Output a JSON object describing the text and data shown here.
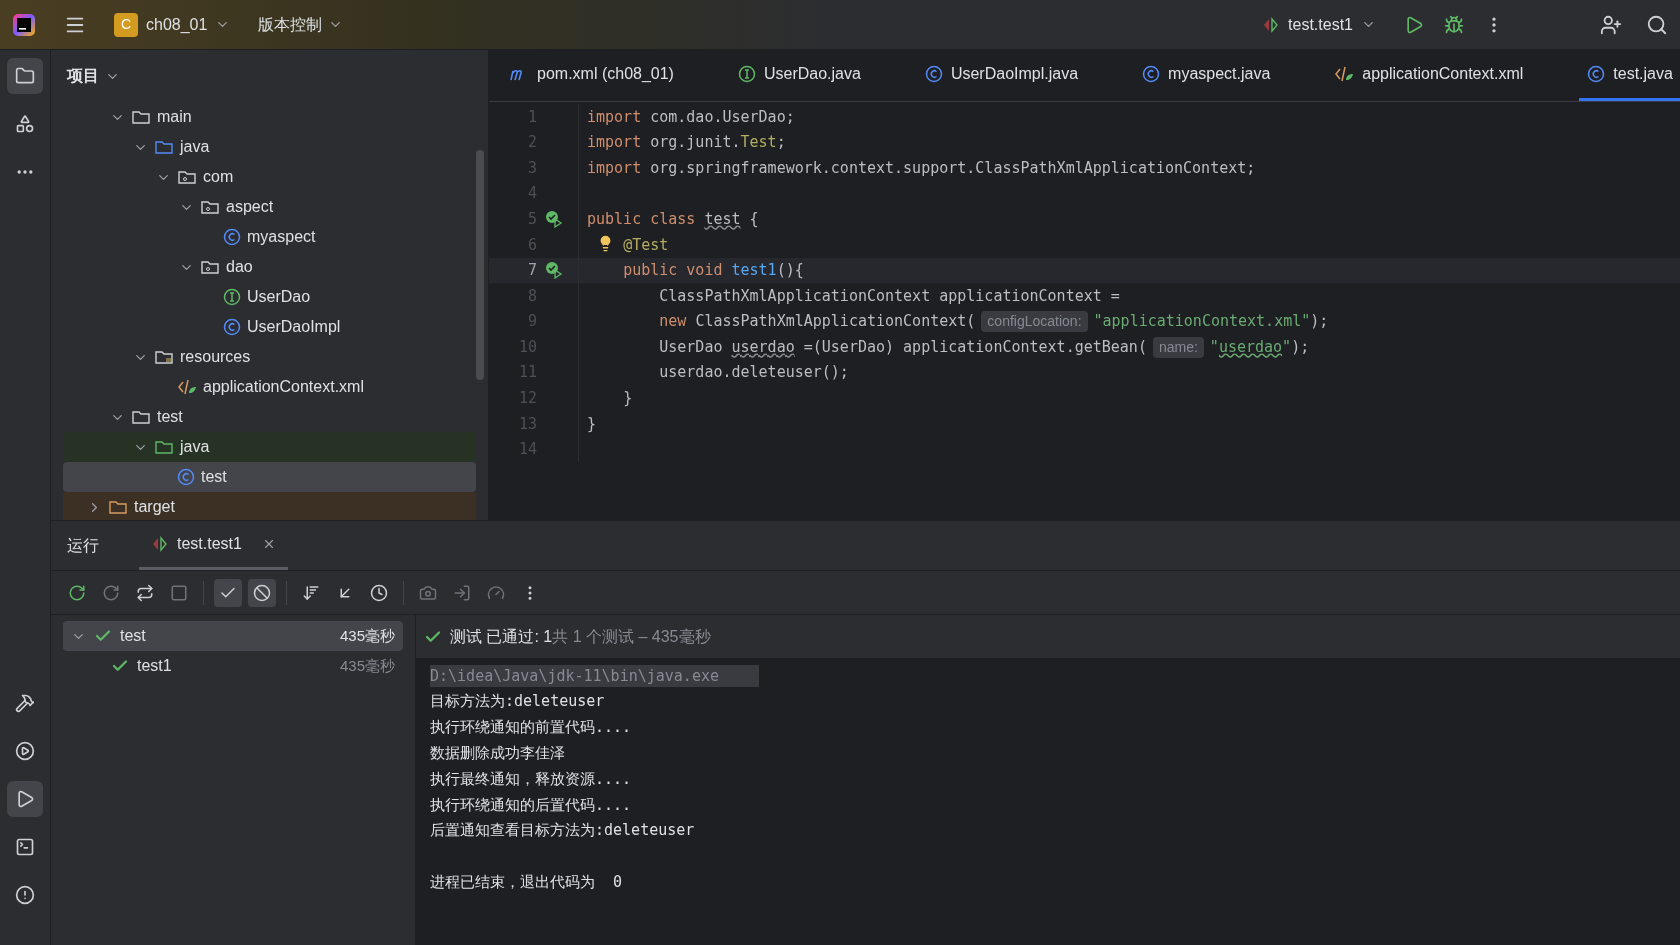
{
  "toolbar": {
    "project_badge": "C",
    "project": "ch08_01",
    "vcs": "版本控制",
    "run_config": "test.test1"
  },
  "left_strip": {
    "top": [
      {
        "kind": "folder",
        "selected": true
      },
      {
        "kind": "structure",
        "selected": false
      },
      {
        "kind": "more",
        "selected": false
      }
    ],
    "bottom": [
      {
        "kind": "build",
        "selected": false
      },
      {
        "kind": "services",
        "selected": false
      },
      {
        "kind": "run",
        "selected": true
      },
      {
        "kind": "terminal",
        "selected": false
      },
      {
        "kind": "problems",
        "selected": false
      }
    ]
  },
  "project_panel": {
    "title": "项目",
    "tree": [
      {
        "children": [
          {
            "label": "main",
            "kind": "folder",
            "expanded": true,
            "selected": false,
            "children": [
              {
                "label": "java",
                "kind": "source",
                "expanded": true,
                "selected": false,
                "children": [
                  {
                    "label": "com",
                    "kind": "package",
                    "expanded": true,
                    "selected": false,
                    "children": [
                      {
                        "label": "aspect",
                        "kind": "package",
                        "expanded": true,
                        "selected": false,
                        "children": [
                          {
                            "label": "myaspect",
                            "kind": "class",
                            "selected": false
                          }
                        ]
                      },
                      {
                        "label": "dao",
                        "kind": "package",
                        "expanded": true,
                        "selected": false,
                        "children": [
                          {
                            "label": "UserDao",
                            "kind": "interface",
                            "selected": false
                          },
                          {
                            "label": "UserDaoImpl",
                            "kind": "class",
                            "selected": false
                          }
                        ]
                      }
                    ]
                  }
                ]
              },
              {
                "label": "resources",
                "kind": "resources",
                "expanded": true,
                "selected": false,
                "children": [
                  {
                    "label": "applicationContext.xml",
                    "kind": "xml",
                    "selected": false
                  }
                ]
              }
            ]
          },
          {
            "label": "test",
            "kind": "folder",
            "expanded": true,
            "selected": false,
            "children": [
              {
                "label": "java",
                "kind": "test-source",
                "expanded": true,
                "selected": false,
                "children": [
                  {
                    "label": "test",
                    "kind": "class",
                    "selected": true
                  }
                ]
              }
            ]
          }
        ]
      },
      {
        "label": "target",
        "kind": "excluded",
        "expanded": false,
        "selected": false
      }
    ]
  },
  "editor_tabs": [
    {
      "label": "pom.xml (ch08_01)",
      "kind": "maven",
      "selected": false
    },
    {
      "label": "UserDao.java",
      "kind": "interface",
      "selected": false
    },
    {
      "label": "UserDaoImpl.java",
      "kind": "class",
      "selected": false
    },
    {
      "label": "myaspect.java",
      "kind": "class",
      "selected": false
    },
    {
      "label": "applicationContext.xml",
      "kind": "xml",
      "selected": false
    },
    {
      "label": "test.java",
      "kind": "class",
      "selected": true
    }
  ],
  "code": [
    {
      "number": "1",
      "tokens": [
        {
          "text": "import ",
          "kind": "keyword"
        },
        {
          "text": "com.dao.UserDao;",
          "kind": "plain"
        }
      ]
    },
    {
      "number": "2",
      "tokens": [
        {
          "text": "import ",
          "kind": "keyword"
        },
        {
          "text": "org.junit.",
          "kind": "plain"
        },
        {
          "text": "Test",
          "kind": "annotation"
        },
        {
          "text": ";",
          "kind": "plain"
        }
      ]
    },
    {
      "number": "3",
      "tokens": [
        {
          "text": "import ",
          "kind": "keyword"
        },
        {
          "text": "org.springframework.context.support.ClassPathXmlApplicationContext;",
          "kind": "plain"
        }
      ]
    },
    {
      "number": "4"
    },
    {
      "number": "5",
      "run_marker": true,
      "tokens": [
        {
          "text": "public class ",
          "kind": "keyword"
        },
        {
          "text": "test",
          "kind": "warn"
        },
        {
          "text": " {",
          "kind": "plain"
        }
      ]
    },
    {
      "number": "6",
      "bulb": true,
      "tokens": [
        {
          "text": "    @Test",
          "kind": "annotation"
        }
      ]
    },
    {
      "number": "7",
      "run_marker": true,
      "current": true,
      "tokens": [
        {
          "text": "    public void ",
          "kind": "keyword"
        },
        {
          "text": "test1",
          "kind": "method"
        },
        {
          "text": "(){",
          "kind": "plain"
        }
      ]
    },
    {
      "number": "8",
      "tokens": [
        {
          "text": "        ClassPathXmlApplicationContext applicationContext =",
          "kind": "plain"
        }
      ]
    },
    {
      "number": "9",
      "tokens": [
        {
          "text": "        new ",
          "kind": "keyword"
        },
        {
          "text": "ClassPathXmlApplicationContext(",
          "kind": "plain"
        },
        {
          "text": "configLocation:",
          "kind": "hint"
        },
        {
          "text": "\"applicationContext.xml\"",
          "kind": "string"
        },
        {
          "text": ");",
          "kind": "plain"
        }
      ]
    },
    {
      "number": "10",
      "tokens": [
        {
          "text": "        UserDao ",
          "kind": "plain"
        },
        {
          "text": "userdao",
          "kind": "warn"
        },
        {
          "text": " =(UserDao) applicationContext.getBean(",
          "kind": "plain"
        },
        {
          "text": "name:",
          "kind": "hint"
        },
        {
          "text": "\"",
          "kind": "string"
        },
        {
          "text": "userdao",
          "kind": "string-warn"
        },
        {
          "text": "\"",
          "kind": "string"
        },
        {
          "text": ");",
          "kind": "plain"
        }
      ]
    },
    {
      "number": "11",
      "tokens": [
        {
          "text": "        userdao.deleteuser();",
          "kind": "plain"
        }
      ]
    },
    {
      "number": "12",
      "tokens": [
        {
          "text": "    }",
          "kind": "plain"
        }
      ]
    },
    {
      "number": "13",
      "tokens": [
        {
          "text": "}",
          "kind": "plain"
        }
      ]
    },
    {
      "number": "14"
    }
  ],
  "run_panel": {
    "title": "运行",
    "tab": {
      "label": "test.test1",
      "selected": true
    },
    "tools": [
      {
        "kind": "rerun",
        "selected": false
      },
      {
        "kind": "rerun-failed",
        "selected": false
      },
      {
        "kind": "toggle-auto",
        "selected": false
      },
      {
        "kind": "stop",
        "selected": false
      },
      {
        "kind": "show-passed",
        "selected": true
      },
      {
        "kind": "show-ignored",
        "selected": true
      },
      {
        "kind": "sort",
        "selected": false
      },
      {
        "kind": "import",
        "selected": false
      },
      {
        "kind": "history",
        "selected": false
      },
      {
        "kind": "camera",
        "selected": false
      },
      {
        "kind": "export",
        "selected": false
      },
      {
        "kind": "coverage",
        "selected": false
      },
      {
        "kind": "more",
        "selected": false
      }
    ],
    "tests": [
      {
        "label": "test",
        "time": "435毫秒",
        "expanded": true,
        "selected": true,
        "children": [
          {
            "label": "test1",
            "time": "435毫秒",
            "selected": false
          }
        ]
      }
    ],
    "status": {
      "passed": "测试 已通过: 1",
      "summary": "共 1 个测试 – 435毫秒"
    },
    "console": [
      {
        "text": "D:\\idea\\Java\\jdk-11\\bin\\java.exe",
        "kind": "command"
      },
      {
        "text": "目标方法为:deleteuser",
        "kind": "output"
      },
      {
        "text": "执行环绕通知的前置代码....",
        "kind": "output"
      },
      {
        "text": "数据删除成功李佳泽",
        "kind": "output"
      },
      {
        "text": "执行最终通知，释放资源....",
        "kind": "output"
      },
      {
        "text": "执行环绕通知的后置代码....",
        "kind": "output"
      },
      {
        "text": "后置通知查看目标方法为:deleteuser",
        "kind": "output"
      },
      {
        "kind": "blank"
      },
      {
        "text": "进程已结束，退出代码为  0",
        "kind": "output"
      }
    ]
  }
}
